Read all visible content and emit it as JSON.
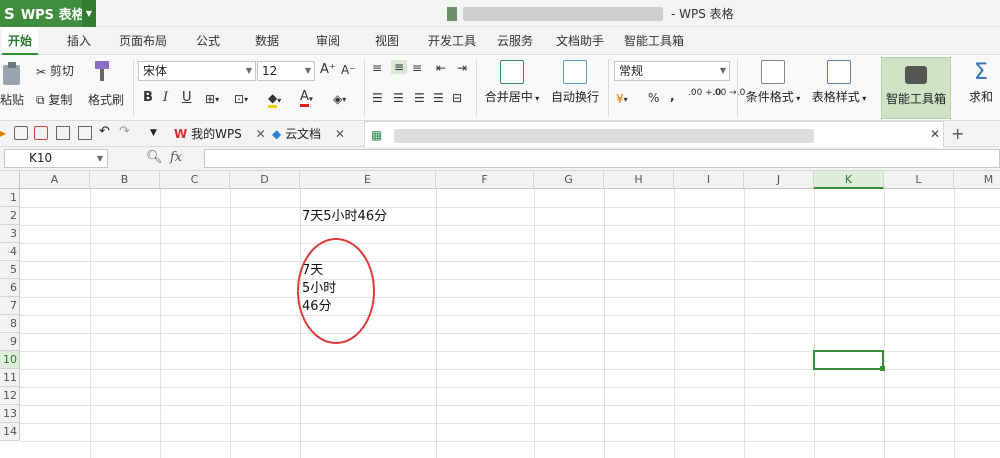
{
  "app": {
    "logo": "S",
    "name": "WPS 表格",
    "window_title_suffix": "- WPS 表格"
  },
  "menu_tabs": [
    "开始",
    "插入",
    "页面布局",
    "公式",
    "数据",
    "审阅",
    "视图",
    "开发工具",
    "云服务",
    "文档助手",
    "智能工具箱"
  ],
  "ribbon": {
    "paste": "粘贴",
    "cut": "剪切",
    "copy": "复制",
    "format_painter": "格式刷",
    "font_name": "宋体",
    "font_size": "12",
    "bold": "B",
    "italic": "I",
    "underline": "U",
    "font_color_letter": "A",
    "grow_font": "A⁺",
    "shrink_font": "A⁻",
    "merge_center": "合并居中",
    "wrap_text": "自动换行",
    "number_format": "常规",
    "percent": "%",
    "comma": ",",
    "inc_decimal": ".00 +.0",
    "dec_decimal": ".00 →.0",
    "conditional_format": "条件格式",
    "table_style": "表格样式",
    "smart_toolbox": "智能工具箱",
    "sum": "求和"
  },
  "doc_tabs": [
    {
      "label": "我的WPS"
    },
    {
      "label": "云文档"
    }
  ],
  "formula_bar": {
    "name_box": "K10",
    "fx": "fx",
    "formula": ""
  },
  "columns": [
    "A",
    "B",
    "C",
    "D",
    "E",
    "F",
    "G",
    "H",
    "I",
    "J",
    "K",
    "L",
    "M"
  ],
  "rows": [
    "1",
    "2",
    "3",
    "4",
    "5",
    "6",
    "7",
    "8",
    "9",
    "10",
    "11",
    "12",
    "13",
    "14"
  ],
  "selected_cell": "K10",
  "cells": {
    "E2": "7天5小时46分",
    "E5": "7天",
    "E6": "5小时",
    "E7": "46分"
  }
}
